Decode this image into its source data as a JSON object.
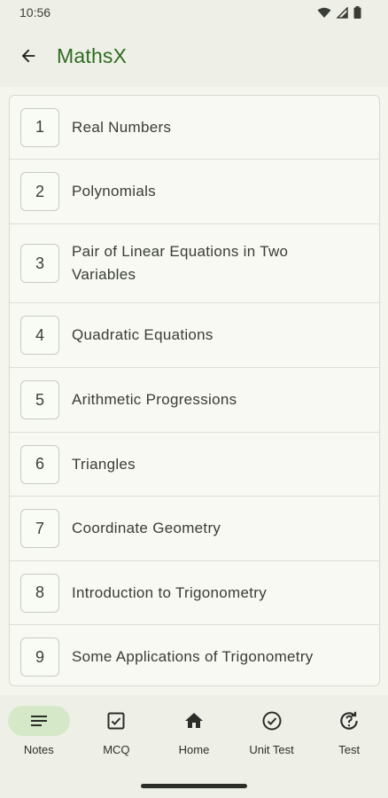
{
  "status_bar": {
    "time": "10:56"
  },
  "app_bar": {
    "title": "MathsX"
  },
  "chapters": [
    {
      "number": "1",
      "title": "Real Numbers"
    },
    {
      "number": "2",
      "title": "Polynomials"
    },
    {
      "number": "3",
      "title": "Pair of Linear Equations in Two Variables"
    },
    {
      "number": "4",
      "title": "Quadratic Equations"
    },
    {
      "number": "5",
      "title": "Arithmetic Progressions"
    },
    {
      "number": "6",
      "title": "Triangles"
    },
    {
      "number": "7",
      "title": "Coordinate Geometry"
    },
    {
      "number": "8",
      "title": "Introduction to Trigonometry"
    },
    {
      "number": "9",
      "title": "Some Applications of Trigonometry"
    }
  ],
  "bottom_nav": {
    "items": [
      {
        "label": "Notes",
        "icon": "notes-icon",
        "active": true
      },
      {
        "label": "MCQ",
        "icon": "checkbox-icon",
        "active": false
      },
      {
        "label": "Home",
        "icon": "home-icon",
        "active": false
      },
      {
        "label": "Unit Test",
        "icon": "check-circle-icon",
        "active": false
      },
      {
        "label": "Test",
        "icon": "quiz-icon",
        "active": false
      }
    ]
  },
  "colors": {
    "accent": "#2f6b1f",
    "active_pill": "#d5e8c8",
    "background": "#f4f6ee"
  }
}
